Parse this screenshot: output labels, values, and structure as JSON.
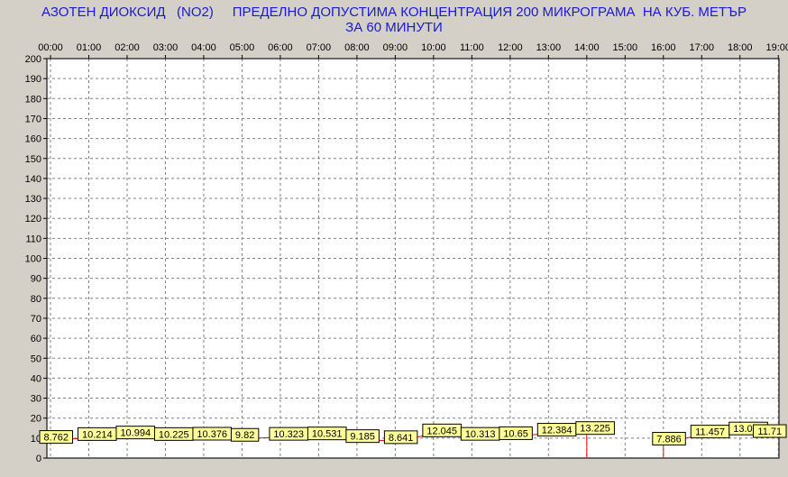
{
  "chart_data": {
    "type": "line",
    "title": "АЗОТЕН ДИОКСИД   (NO2)     ПРЕДЕЛНО ДОПУСТИМА КОНЦЕНТРАЦИЯ 200 МИКРОГРАМА  НА КУБ. МЕТЪР",
    "subtitle": "ЗА 60 МИНУТИ",
    "xlabel": "",
    "ylabel": "",
    "x": [
      "00:00",
      "01:00",
      "02:00",
      "03:00",
      "04:00",
      "05:00",
      "06:00",
      "07:00",
      "08:00",
      "09:00",
      "10:00",
      "11:00",
      "12:00",
      "13:00",
      "14:00",
      "15:00",
      "16:00",
      "17:00",
      "18:00",
      "19:00"
    ],
    "ylim": [
      0,
      200
    ],
    "yticks": [
      0,
      10,
      20,
      30,
      40,
      50,
      60,
      70,
      80,
      90,
      100,
      110,
      120,
      130,
      140,
      150,
      160,
      170,
      180,
      190,
      200
    ],
    "grid": true,
    "series": [
      {
        "values": [
          8.762,
          10.214,
          10.994,
          10.225,
          10.376,
          9.82,
          10.323,
          10.531,
          9.185,
          8.641,
          12.045,
          10.313,
          10.65,
          12.384,
          13.225,
          null,
          7.886,
          11.457,
          13.002,
          11.71
        ],
        "labels": [
          "8.762",
          "10.214",
          "10.994",
          "10.225",
          "10.376",
          "9.82",
          "10.323",
          "10.531",
          "9.185",
          "8.641",
          "12.045",
          "10.313",
          "10.65",
          "12.384",
          "13.225",
          "",
          "7.886",
          "11.457",
          "13.002",
          "11.71"
        ]
      }
    ],
    "colors": {
      "background": "#d4d0c8",
      "plot_background": "#ffffff",
      "grid": "#808080",
      "line": "#ff0000",
      "marker": "#cc0000",
      "label_fill": "#ffff99",
      "title": "#1a1ad0"
    }
  }
}
